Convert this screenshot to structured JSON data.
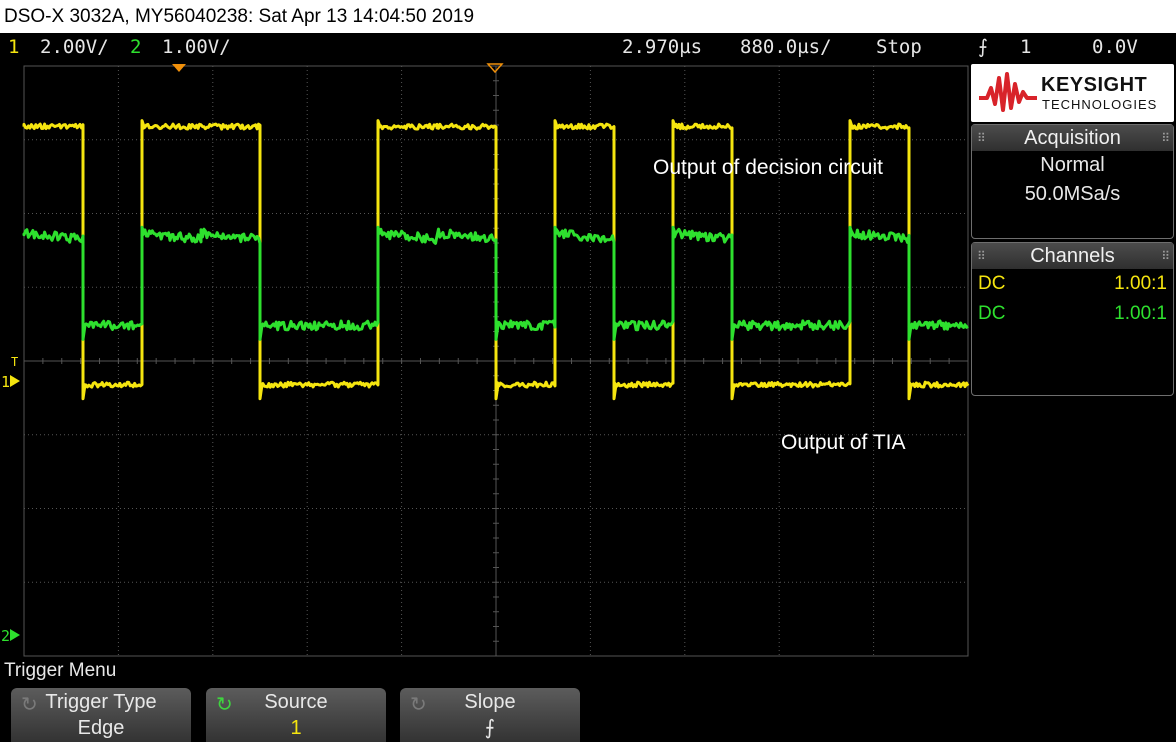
{
  "title_bar": "DSO-X 3032A, MY56040238: Sat Apr 13 14:04:50 2019",
  "status": {
    "ch1_num": "1",
    "ch1_scale": "2.00V/",
    "ch2_num": "2",
    "ch2_scale": "1.00V/",
    "delay": "2.970µs",
    "timebase": "880.0µs/",
    "run_state": "Stop",
    "trigger_slope_icon": "⨍",
    "trigger_source": "1",
    "trigger_level": "0.0V"
  },
  "brand": {
    "name": "KEYSIGHT",
    "subtitle": "TECHNOLOGIES"
  },
  "acquisition": {
    "heading": "Acquisition",
    "mode": "Normal",
    "sample_rate": "50.0MSa/s"
  },
  "channels": {
    "heading": "Channels",
    "rows": [
      {
        "coupling": "DC",
        "probe": "1.00:1",
        "color": "#f5e50f"
      },
      {
        "coupling": "DC",
        "probe": "1.00:1",
        "color": "#2ee02e"
      }
    ]
  },
  "annotations": {
    "ch1": "Output of decision circuit",
    "ch2": "Output of TIA"
  },
  "markers": {
    "ch1_ground": "1",
    "ch2_ground": "2",
    "trigger_level": "T"
  },
  "colors": {
    "ch1": "#f5e50f",
    "ch2": "#2ee02e",
    "grid": "#555555"
  },
  "menu": {
    "title": "Trigger Menu",
    "softkeys": [
      {
        "label": "Trigger Type",
        "value": "Edge"
      },
      {
        "label": "Source",
        "value": "1"
      },
      {
        "label": "Slope",
        "value": "⨍"
      }
    ]
  },
  "waveform_data": {
    "bit_pattern": [
      1,
      0,
      1,
      1,
      0,
      0,
      1,
      1,
      0,
      1,
      0,
      1,
      0,
      0,
      1,
      0
    ],
    "ch1_high_div": 3.45,
    "ch1_low_div": -0.05,
    "ch2_high_div": 1.15,
    "ch2_low_div": -0.1
  }
}
